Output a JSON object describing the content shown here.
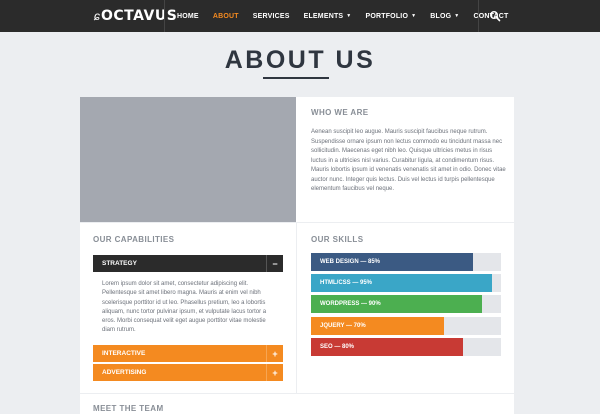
{
  "navbar": {
    "logo": "OCTAVUS",
    "items": [
      {
        "label": "HOME"
      },
      {
        "label": "ABOUT"
      },
      {
        "label": "SERVICES"
      },
      {
        "label": "ELEMENTS"
      },
      {
        "label": "PORTFOLIO"
      },
      {
        "label": "BLOG"
      },
      {
        "label": "CONTACT"
      }
    ],
    "active": "ABOUT",
    "search_icon": "search-icon"
  },
  "page": {
    "title": "ABOUT US"
  },
  "who_we_are": {
    "title": "WHO WE ARE",
    "text": "Aenean suscipit leo augue. Mauris suscipit faucibus neque rutrum. Suspendisse ornare ipsum non lectus commodo eu tincidunt massa nec sollicitudin. Maecenas eget nibh leo. Quisque ultricies metus in risus luctus in a ultricies nisl varius. Curabitur ligula, at condimentum risus. Mauris lobortis ipsum id venenatis venenatis sit amet in odio. Donec vitae auctor nunc. Integer quis lectus. Duis vel lectus id turpis pellentesque elementum faucibus vel neque."
  },
  "capabilities": {
    "title": "OUR CAPABILITIES",
    "items": [
      {
        "label": "STRATEGY",
        "toggle": "−"
      },
      {
        "label": "INTERACTIVE",
        "toggle": "+"
      },
      {
        "label": "ADVERTISING",
        "toggle": "+"
      }
    ],
    "open_text": "Lorem ipsum dolor sit amet, consectetur adipiscing elit. Pellentesque sit amet libero magna. Mauris at enim vel nibh scelerisque porttitor id ut leo. Phasellus pretium, leo a lobortis aliquam, nunc tortor pulvinar ipsum, et vulputate lacus tortor a eros. Morbi consequat velit eget augue porttitor vitae molestie diam rutrum."
  },
  "skills": {
    "title": "OUR SKILLS",
    "items": [
      {
        "label": "WEB DESIGN — 85%",
        "percent": 85,
        "color": "#3b5a83"
      },
      {
        "label": "HTML/CSS — 95%",
        "percent": 95,
        "color": "#3aa6c7"
      },
      {
        "label": "WORDPRESS — 90%",
        "percent": 90,
        "color": "#4caf50"
      },
      {
        "label": "JQUERY — 70%",
        "percent": 70,
        "color": "#f48a20"
      },
      {
        "label": "SEO — 80%",
        "percent": 80,
        "color": "#c83a34"
      }
    ]
  },
  "team": {
    "title": "MEET THE TEAM"
  },
  "colors": {
    "accent": "#f48a20",
    "navbar": "#2b2b2b"
  }
}
